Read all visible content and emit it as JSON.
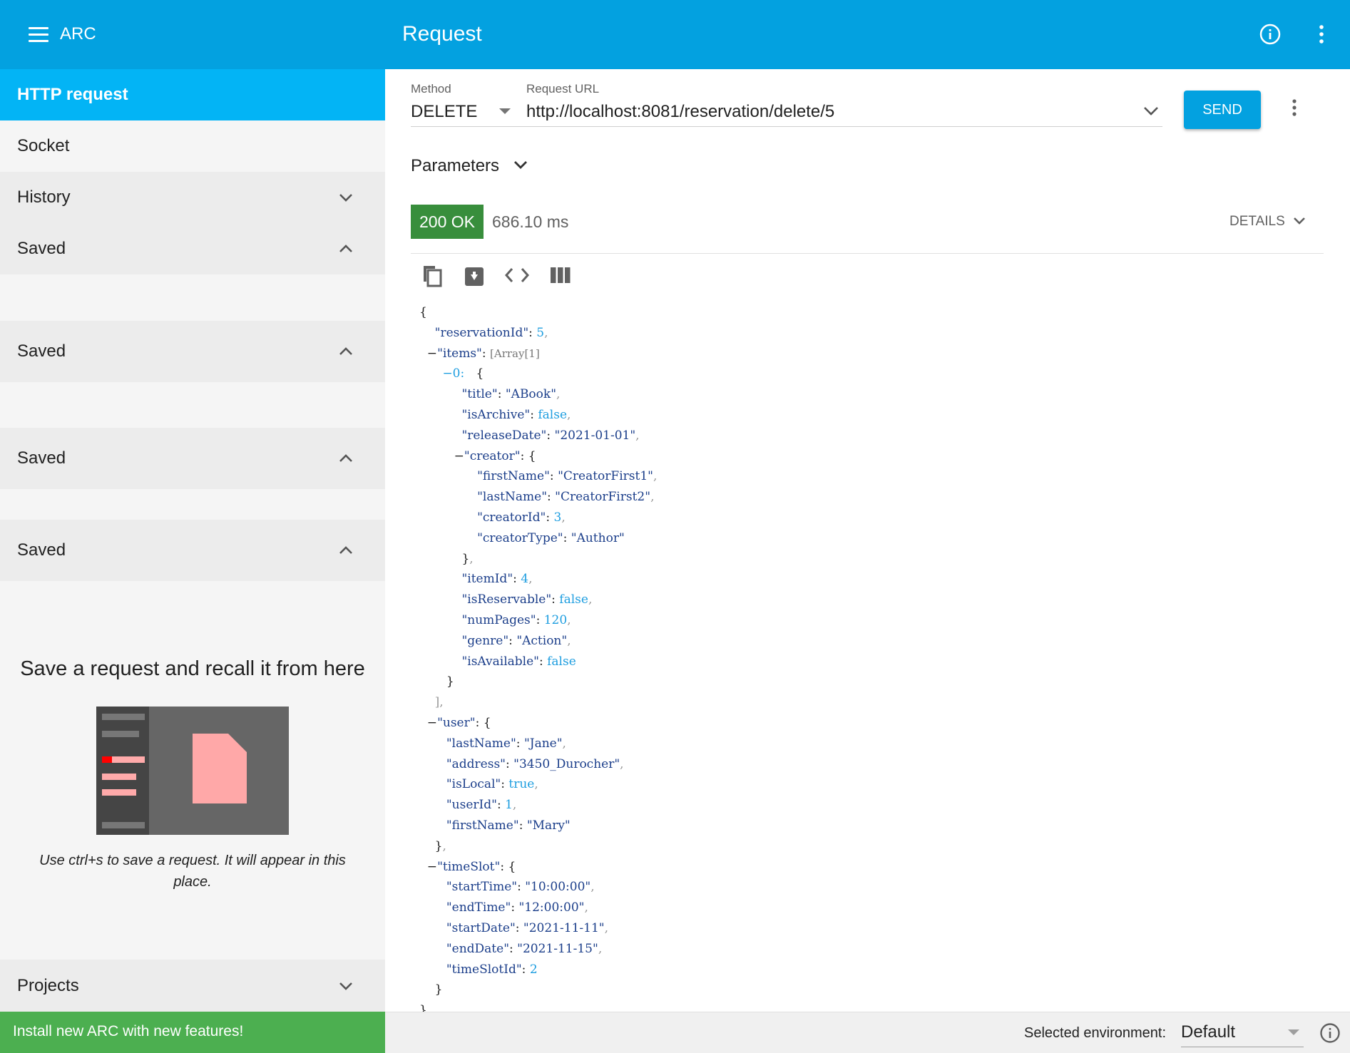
{
  "topbar": {
    "app_title": "ARC",
    "page_title": "Request",
    "color": "#03a1e0"
  },
  "sidebar": {
    "items": [
      {
        "label": "HTTP request"
      },
      {
        "label": "Socket"
      },
      {
        "label": "History"
      },
      {
        "label": "Saved"
      },
      {
        "label": "Saved"
      },
      {
        "label": "Saved"
      },
      {
        "label": "Saved"
      },
      {
        "label": "Projects"
      }
    ],
    "empty_title": "Save a request and recall it from here",
    "empty_hint": "Use ctrl+s to save a request. It will appear in this place.",
    "install_banner": "Install new ARC with new features!"
  },
  "request": {
    "method_label": "Method",
    "method_value": "DELETE",
    "url_label": "Request URL",
    "url_value": "http://localhost:8081/reservation/delete/5",
    "send_label": "SEND",
    "parameters_label": "Parameters"
  },
  "response": {
    "status": "200 OK",
    "status_color": "#388e3c",
    "time": "686.10 ms",
    "details_label": "DETAILS"
  },
  "footer": {
    "env_label": "Selected environment:",
    "env_value": "Default"
  }
}
